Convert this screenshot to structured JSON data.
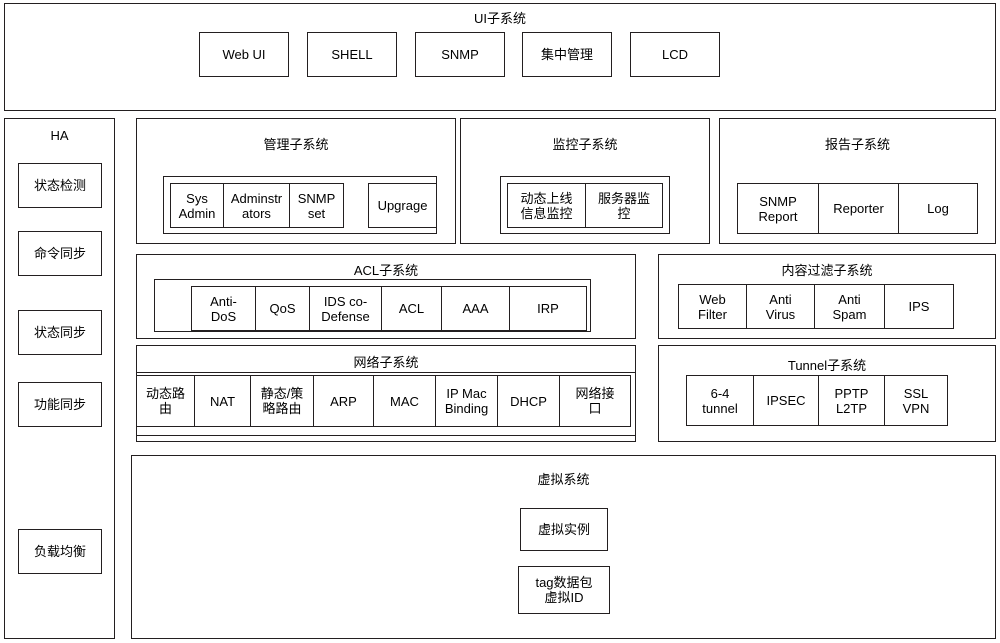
{
  "diagram": {
    "ui_subsystem": {
      "title": "UI子系统",
      "items": [
        "Web UI",
        "SHELL",
        "SNMP",
        "集中管理",
        "LCD"
      ]
    },
    "ha": {
      "title": "HA",
      "items": [
        "状态检测",
        "命令同步",
        "状态同步",
        "功能同步",
        "负载均衡"
      ]
    },
    "manage_subsystem": {
      "title": "管理子系统",
      "items": [
        "Sys\nAdmin",
        "Adminstr\nators",
        "SNMP\nset",
        "Upgrage"
      ]
    },
    "monitor_subsystem": {
      "title": "监控子系统",
      "items": [
        "动态上线\n信息监控",
        "服务器监\n控"
      ]
    },
    "report_subsystem": {
      "title": "报告子系统",
      "items": [
        "SNMP\nReport",
        "Reporter",
        "Log"
      ]
    },
    "acl_subsystem": {
      "title": "ACL子系统",
      "items": [
        "Anti-\nDoS",
        "QoS",
        "IDS co-\nDefense",
        "ACL",
        "AAA",
        "IRP"
      ]
    },
    "content_filter_subsystem": {
      "title": "内容过滤子系统",
      "items": [
        "Web\nFilter",
        "Anti\nVirus",
        "Anti\nSpam",
        "IPS"
      ]
    },
    "network_subsystem": {
      "title": "网络子系统",
      "items": [
        "动态路\n由",
        "NAT",
        "静态/策\n略路由",
        "ARP",
        "MAC",
        "IP Mac\nBinding",
        "DHCP",
        "网络接\n口"
      ]
    },
    "tunnel_subsystem": {
      "title": "Tunnel子系统",
      "items": [
        "6-4\ntunnel",
        "IPSEC",
        "PPTP\nL2TP",
        "SSL\nVPN"
      ]
    },
    "virtual_subsystem": {
      "title": "虚拟系统",
      "items": [
        "虚拟实例",
        "tag数据包\n虚拟ID"
      ]
    }
  }
}
